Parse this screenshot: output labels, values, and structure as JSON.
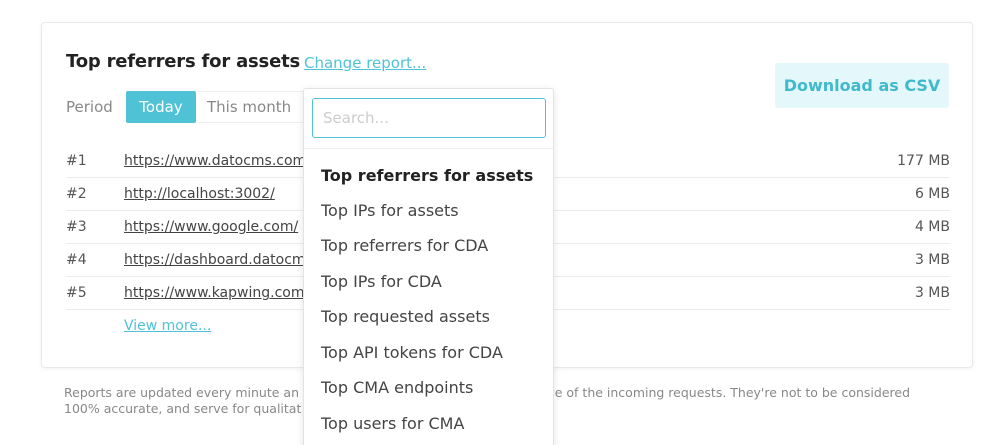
{
  "report": {
    "title": "Top referrers for assets",
    "change_link": "Change report...",
    "download_label": "Download as CSV"
  },
  "period": {
    "label": "Period",
    "options": [
      "Today",
      "This month"
    ],
    "selected": "Today"
  },
  "rows": [
    {
      "rank": "#1",
      "url": "https://www.datocms.com",
      "size": "177 MB"
    },
    {
      "rank": "#2",
      "url": "http://localhost:3002/",
      "size": "6 MB"
    },
    {
      "rank": "#3",
      "url": "https://www.google.com/",
      "size": "4 MB"
    },
    {
      "rank": "#4",
      "url": "https://dashboard.datocm",
      "size": "3 MB"
    },
    {
      "rank": "#5",
      "url": "https://www.kapwing.com",
      "size": "3 MB"
    }
  ],
  "view_more": "View more...",
  "footnote": {
    "line1_left": "Reports are updated every minute an",
    "line1_right": "rce of the incoming requests. They're not to be considered",
    "line2": "100% accurate, and serve for qualitat"
  },
  "dropdown": {
    "search_placeholder": "Search...",
    "items": [
      {
        "label": "Top referrers for assets",
        "active": true
      },
      {
        "label": "Top IPs for assets"
      },
      {
        "label": "Top referrers for CDA"
      },
      {
        "label": "Top IPs for CDA"
      },
      {
        "label": "Top requested assets"
      },
      {
        "label": "Top API tokens for CDA"
      },
      {
        "label": "Top CMA endpoints"
      },
      {
        "label": "Top users for CMA"
      }
    ]
  },
  "colors": {
    "accent": "#4fc3d5",
    "button_bg": "#e4f7fa"
  }
}
